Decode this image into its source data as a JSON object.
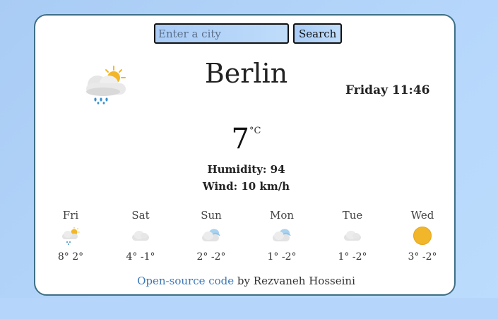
{
  "search": {
    "placeholder": "Enter a city",
    "button_label": "Search"
  },
  "current": {
    "city": "Berlin",
    "day_time": "Friday 11:46",
    "temperature": "7",
    "unit": "°C",
    "humidity": "Humidity: 94",
    "wind": "Wind: 10 km/h",
    "icon": "partly-cloudy-rain-icon"
  },
  "forecast": [
    {
      "day": "Fri",
      "temps": "8° 2°",
      "icon": "partly-cloudy-rain-icon"
    },
    {
      "day": "Sat",
      "temps": "4° -1°",
      "icon": "cloud-icon"
    },
    {
      "day": "Sun",
      "temps": "2° -2°",
      "icon": "cloudy-icon"
    },
    {
      "day": "Mon",
      "temps": "1° -2°",
      "icon": "cloudy-icon"
    },
    {
      "day": "Tue",
      "temps": "1° -2°",
      "icon": "cloud-icon"
    },
    {
      "day": "Wed",
      "temps": "3° -2°",
      "icon": "sun-icon"
    }
  ],
  "footer": {
    "link_text": "Open-source code",
    "credit": " by Rezvaneh Hosseini"
  },
  "colors": {
    "background": "#b6d7fb",
    "card_border": "#3e6f86",
    "link": "#3b77b5",
    "sun": "#f2b62a"
  }
}
